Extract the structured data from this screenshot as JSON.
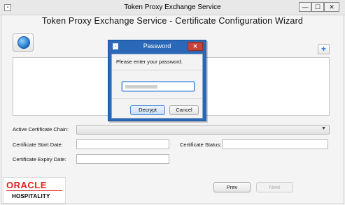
{
  "window": {
    "title": "Token Proxy Exchange Service",
    "minimize_glyph": "—",
    "maximize_glyph": "☐",
    "close_glyph": "✕"
  },
  "wizard": {
    "title": "Token Proxy Exchange Service - Certificate Configuration Wizard",
    "add_glyph": "+"
  },
  "form": {
    "active_chain_label": "Active Certificate Chain:",
    "active_chain_value": "",
    "start_date_label": "Certificate Start Date:",
    "start_date_value": "",
    "status_label": "Certificate Status:",
    "status_value": "",
    "expiry_date_label": "Certificate Expiry Date:",
    "expiry_date_value": ""
  },
  "logo": {
    "brand": "ORACLE",
    "sub": "HOSPITALITY"
  },
  "nav": {
    "prev_label": "Prev",
    "next_label": "Next"
  },
  "dialog": {
    "title": "Password",
    "message": "Please enter your password.",
    "decrypt_label": "Decrypt",
    "cancel_label": "Cancel",
    "close_glyph": "✕"
  },
  "colors": {
    "dialog_frame": "#2b69b8",
    "close_red": "#c7433a",
    "oracle_red": "#e2231a"
  }
}
